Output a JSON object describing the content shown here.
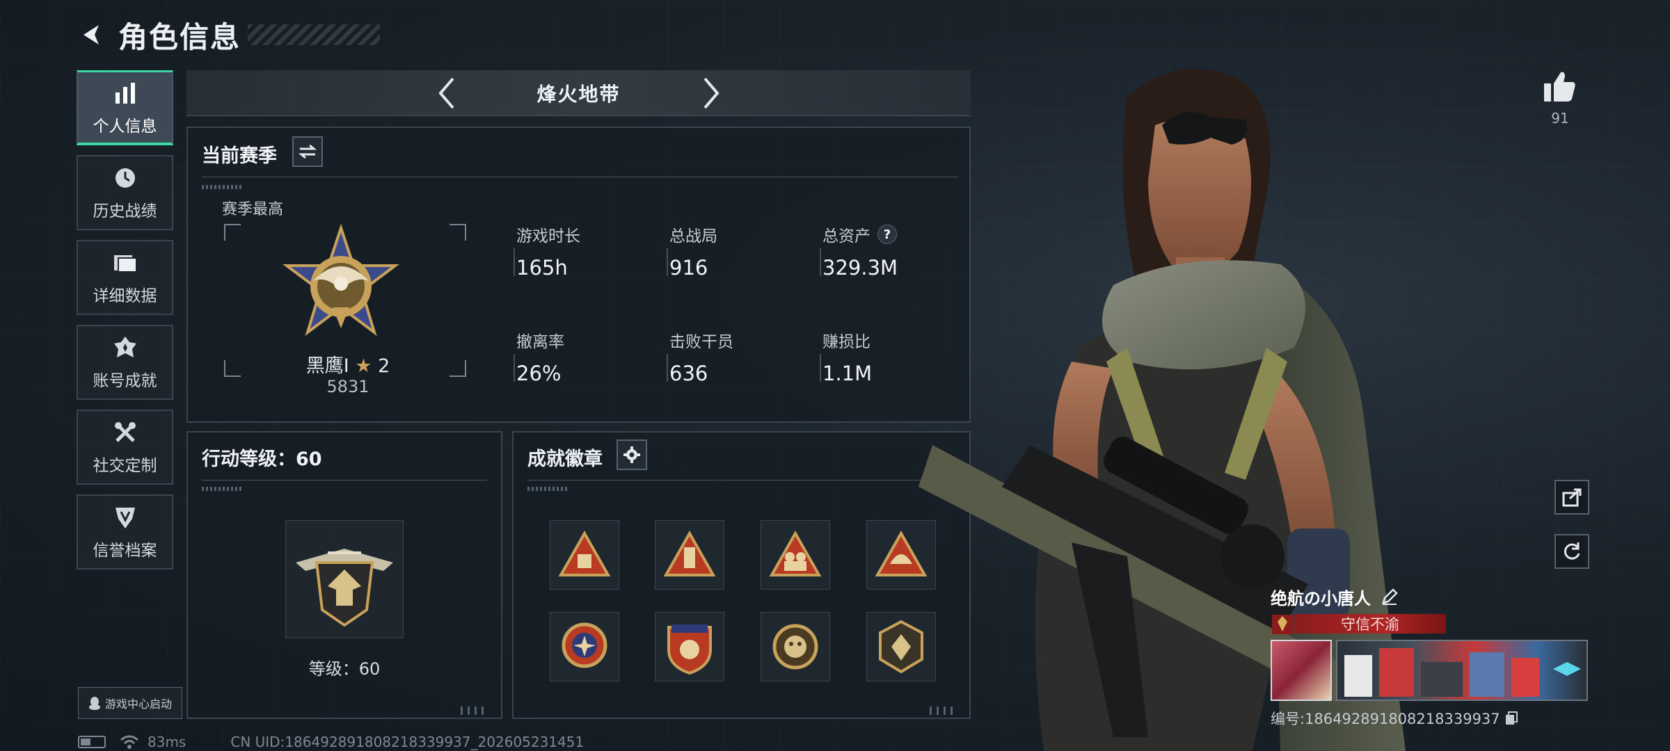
{
  "header": {
    "title": "角色信息"
  },
  "nav": {
    "items": [
      {
        "label": "个人信息",
        "icon": "bar-chart-icon",
        "active": true
      },
      {
        "label": "历史战绩",
        "icon": "history-clock-icon"
      },
      {
        "label": "详细数据",
        "icon": "folder-icon"
      },
      {
        "label": "账号成就",
        "icon": "achievement-icon"
      },
      {
        "label": "社交定制",
        "icon": "tools-icon"
      },
      {
        "label": "信誉档案",
        "icon": "shield-icon"
      }
    ]
  },
  "switcher": {
    "title": "烽火地带"
  },
  "season": {
    "title": "当前赛季",
    "best_label": "赛季最高",
    "rank_name": "黑鹰I",
    "rank_stars": "2",
    "rank_score": "5831",
    "stats": [
      {
        "label": "游戏时长",
        "value": "165h"
      },
      {
        "label": "总战局",
        "value": "916"
      },
      {
        "label": "总资产",
        "value": "329.3M",
        "help": "?"
      },
      {
        "label": "撤离率",
        "value": "26%"
      },
      {
        "label": "击败干员",
        "value": "636"
      },
      {
        "label": "赚损比",
        "value": "1.1M"
      }
    ]
  },
  "level": {
    "title": "行动等级：60",
    "label": "等级：60"
  },
  "badges": {
    "title": "成就徽章",
    "count": 8,
    "accent": "#c8a15a"
  },
  "launch": {
    "label": "游戏中心启动"
  },
  "status": {
    "ping": "83ms",
    "uid": "CN UID:186492891808218339937_202605231451"
  },
  "likes": {
    "count": "91"
  },
  "player": {
    "name": "绝航の小唐人",
    "title": "守信不渝",
    "id": "编号:186492891808218339937"
  },
  "colors": {
    "accent": "#3ed6a5",
    "title_red": "#b02525"
  }
}
